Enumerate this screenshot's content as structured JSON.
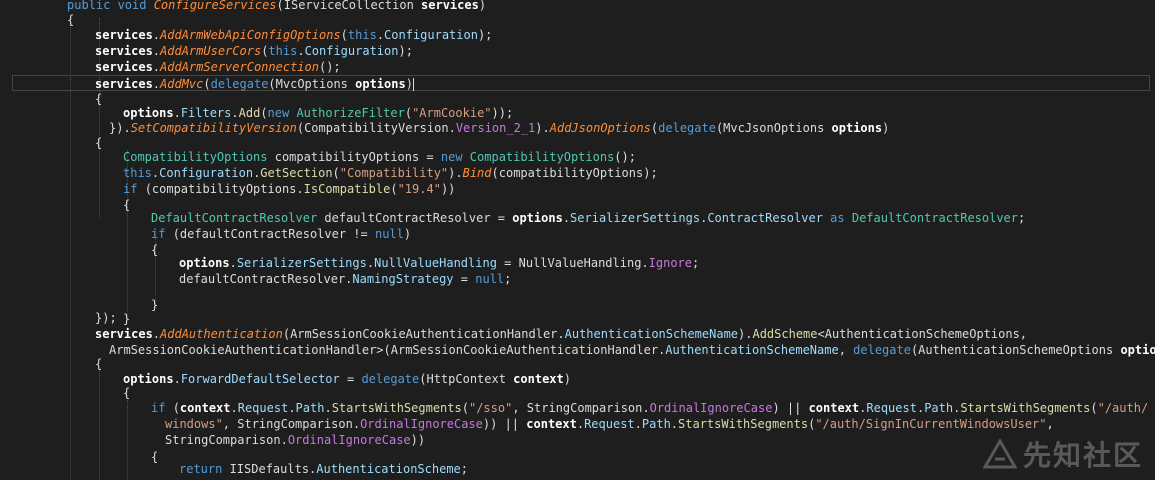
{
  "colors": {
    "background": "#1e1e1e",
    "text": "#dcdcdc",
    "keyword": "#569cd6",
    "type": "#4ec9b0",
    "method": "#dcdcaa",
    "extension_method": "#ff8c3a",
    "property": "#9cdcfe",
    "string": "#d69d85",
    "enum_value": "#c678dd",
    "parameter": "#ffffff"
  },
  "code": {
    "lines": [
      [
        [
          "kw",
          "public "
        ],
        [
          "kw",
          "void "
        ],
        [
          "ex",
          "ConfigureServices"
        ],
        [
          "tx",
          "(IServiceCollection "
        ],
        [
          "pa",
          "services"
        ],
        [
          "tx",
          ")"
        ]
      ],
      [
        [
          "tx",
          "{"
        ]
      ],
      [
        [
          "pa",
          "services"
        ],
        [
          "tx",
          "."
        ],
        [
          "ex",
          "AddArmWebApiConfigOptions"
        ],
        [
          "tx",
          "("
        ],
        [
          "kw",
          "this"
        ],
        [
          "tx",
          "."
        ],
        [
          "pr",
          "Configuration"
        ],
        [
          "tx",
          ");"
        ]
      ],
      [
        [
          "pa",
          "services"
        ],
        [
          "tx",
          "."
        ],
        [
          "ex",
          "AddArmUserCors"
        ],
        [
          "tx",
          "("
        ],
        [
          "kw",
          "this"
        ],
        [
          "tx",
          "."
        ],
        [
          "pr",
          "Configuration"
        ],
        [
          "tx",
          ");"
        ]
      ],
      [
        [
          "pa",
          "services"
        ],
        [
          "tx",
          "."
        ],
        [
          "ex",
          "AddArmServerConnection"
        ],
        [
          "tx",
          "();"
        ]
      ],
      [
        [
          "pa",
          "services"
        ],
        [
          "tx",
          "."
        ],
        [
          "ex",
          "AddMvc"
        ],
        [
          "tx",
          "("
        ],
        [
          "kw",
          "delegate"
        ],
        [
          "tx",
          "(MvcOptions "
        ],
        [
          "pa",
          "options"
        ],
        [
          "tx",
          ")"
        ]
      ],
      [
        [
          "tx",
          "{"
        ]
      ],
      [
        [
          "pa",
          "options"
        ],
        [
          "tx",
          "."
        ],
        [
          "pr",
          "Filters"
        ],
        [
          "tx",
          "."
        ],
        [
          "mt",
          "Add"
        ],
        [
          "tx",
          "("
        ],
        [
          "kw",
          "new "
        ],
        [
          "ty",
          "AuthorizeFilter"
        ],
        [
          "tx",
          "("
        ],
        [
          "st",
          "\"ArmCookie\""
        ],
        [
          "tx",
          "));"
        ]
      ],
      [
        [
          "tx",
          "})."
        ],
        [
          "ex",
          "SetCompatibilityVersion"
        ],
        [
          "tx",
          "(CompatibilityVersion."
        ],
        [
          "ev",
          "Version_2_1"
        ],
        [
          "tx",
          ")."
        ],
        [
          "ex",
          "AddJsonOptions"
        ],
        [
          "tx",
          "("
        ],
        [
          "kw",
          "delegate"
        ],
        [
          "tx",
          "(MvcJsonOptions "
        ],
        [
          "pa",
          "options"
        ],
        [
          "tx",
          ")"
        ]
      ],
      [
        [
          "tx",
          "{"
        ]
      ],
      [
        [
          "ty",
          "CompatibilityOptions "
        ],
        [
          "tx",
          "compatibilityOptions = "
        ],
        [
          "kw",
          "new "
        ],
        [
          "ty",
          "CompatibilityOptions"
        ],
        [
          "tx",
          "();"
        ]
      ],
      [
        [
          "kw",
          "this"
        ],
        [
          "tx",
          "."
        ],
        [
          "pr",
          "Configuration"
        ],
        [
          "tx",
          "."
        ],
        [
          "mt",
          "GetSection"
        ],
        [
          "tx",
          "("
        ],
        [
          "st",
          "\"Compatibility\""
        ],
        [
          "tx",
          ")."
        ],
        [
          "ex",
          "Bind"
        ],
        [
          "tx",
          "(compatibilityOptions);"
        ]
      ],
      [
        [
          "kw",
          "if "
        ],
        [
          "tx",
          "(compatibilityOptions."
        ],
        [
          "mt",
          "IsCompatible"
        ],
        [
          "tx",
          "("
        ],
        [
          "st",
          "\"19.4\""
        ],
        [
          "tx",
          "))"
        ]
      ],
      [
        [
          "tx",
          "{"
        ]
      ],
      [
        [
          "ty",
          "DefaultContractResolver "
        ],
        [
          "tx",
          "defaultContractResolver = "
        ],
        [
          "pa",
          "options"
        ],
        [
          "tx",
          "."
        ],
        [
          "pr",
          "SerializerSettings"
        ],
        [
          "tx",
          "."
        ],
        [
          "pr",
          "ContractResolver "
        ],
        [
          "kw",
          "as "
        ],
        [
          "ty",
          "DefaultContractResolver"
        ],
        [
          "tx",
          ";"
        ]
      ],
      [
        [
          "kw",
          "if "
        ],
        [
          "tx",
          "(defaultContractResolver != "
        ],
        [
          "kw",
          "null"
        ],
        [
          "tx",
          ")"
        ]
      ],
      [
        [
          "tx",
          "{"
        ]
      ],
      [
        [
          "pa",
          "options"
        ],
        [
          "tx",
          "."
        ],
        [
          "pr",
          "SerializerSettings"
        ],
        [
          "tx",
          "."
        ],
        [
          "pr",
          "NullValueHandling"
        ],
        [
          "tx",
          " = NullValueHandling."
        ],
        [
          "ev",
          "Ignore"
        ],
        [
          "tx",
          ";"
        ]
      ],
      [
        [
          "tx",
          "defaultContractResolver."
        ],
        [
          "pr",
          "NamingStrategy"
        ],
        [
          "tx",
          " = "
        ],
        [
          "kw",
          "null"
        ],
        [
          "tx",
          ";"
        ]
      ],
      [
        [
          "tx",
          "}"
        ]
      ],
      [
        [
          "tx",
          "}"
        ]
      ],
      [
        [
          "tx",
          "});"
        ]
      ],
      [
        [
          "pa",
          "services"
        ],
        [
          "tx",
          "."
        ],
        [
          "ex",
          "AddAuthentication"
        ],
        [
          "tx",
          "(ArmSessionCookieAuthenticationHandler."
        ],
        [
          "pr",
          "AuthenticationSchemeName"
        ],
        [
          "tx",
          ")."
        ],
        [
          "mt",
          "AddScheme"
        ],
        [
          "tx",
          "<AuthenticationSchemeOptions,"
        ]
      ],
      [
        [
          "tx",
          "ArmSessionCookieAuthenticationHandler>(ArmSessionCookieAuthenticationHandler."
        ],
        [
          "pr",
          "AuthenticationSchemeName"
        ],
        [
          "tx",
          ", "
        ],
        [
          "kw",
          "delegate"
        ],
        [
          "tx",
          "(AuthenticationSchemeOptions "
        ],
        [
          "pa",
          "options"
        ],
        [
          "tx",
          ")"
        ]
      ],
      [
        [
          "tx",
          "{"
        ]
      ],
      [
        [
          "pa",
          "options"
        ],
        [
          "tx",
          "."
        ],
        [
          "pr",
          "ForwardDefaultSelector"
        ],
        [
          "tx",
          " = "
        ],
        [
          "kw",
          "delegate"
        ],
        [
          "tx",
          "(HttpContext "
        ],
        [
          "pa",
          "context"
        ],
        [
          "tx",
          ")"
        ]
      ],
      [
        [
          "tx",
          "{"
        ]
      ],
      [
        [
          "kw",
          "if "
        ],
        [
          "tx",
          "("
        ],
        [
          "pa",
          "context"
        ],
        [
          "tx",
          "."
        ],
        [
          "pr",
          "Request"
        ],
        [
          "tx",
          "."
        ],
        [
          "pr",
          "Path"
        ],
        [
          "tx",
          "."
        ],
        [
          "mt",
          "StartsWithSegments"
        ],
        [
          "tx",
          "("
        ],
        [
          "st",
          "\"/sso\""
        ],
        [
          "tx",
          ", StringComparison."
        ],
        [
          "ev",
          "OrdinalIgnoreCase"
        ],
        [
          "tx",
          ") || "
        ],
        [
          "pa",
          "context"
        ],
        [
          "tx",
          "."
        ],
        [
          "pr",
          "Request"
        ],
        [
          "tx",
          "."
        ],
        [
          "pr",
          "Path"
        ],
        [
          "tx",
          "."
        ],
        [
          "mt",
          "StartsWithSegments"
        ],
        [
          "tx",
          "("
        ],
        [
          "st",
          "\"/auth/"
        ]
      ],
      [
        [
          "st",
          "windows\""
        ],
        [
          "tx",
          ", StringComparison."
        ],
        [
          "ev",
          "OrdinalIgnoreCase"
        ],
        [
          "tx",
          ")) || "
        ],
        [
          "pa",
          "context"
        ],
        [
          "tx",
          "."
        ],
        [
          "pr",
          "Request"
        ],
        [
          "tx",
          "."
        ],
        [
          "pr",
          "Path"
        ],
        [
          "tx",
          "."
        ],
        [
          "mt",
          "StartsWithSegments"
        ],
        [
          "tx",
          "("
        ],
        [
          "st",
          "\"/auth/SignInCurrentWindowsUser\""
        ],
        [
          "tx",
          ","
        ]
      ],
      [
        [
          "tx",
          "StringComparison."
        ],
        [
          "ev",
          "OrdinalIgnoreCase"
        ],
        [
          "tx",
          "))"
        ]
      ],
      [
        [
          "tx",
          "{"
        ]
      ],
      [
        [
          "kw",
          "return "
        ],
        [
          "tx",
          "IISDefaults."
        ],
        [
          "pr",
          "AuthenticationScheme"
        ],
        [
          "tx",
          ";"
        ]
      ]
    ]
  },
  "watermark": {
    "text": "先知社区",
    "icon": "xianzhi-logo-icon"
  }
}
